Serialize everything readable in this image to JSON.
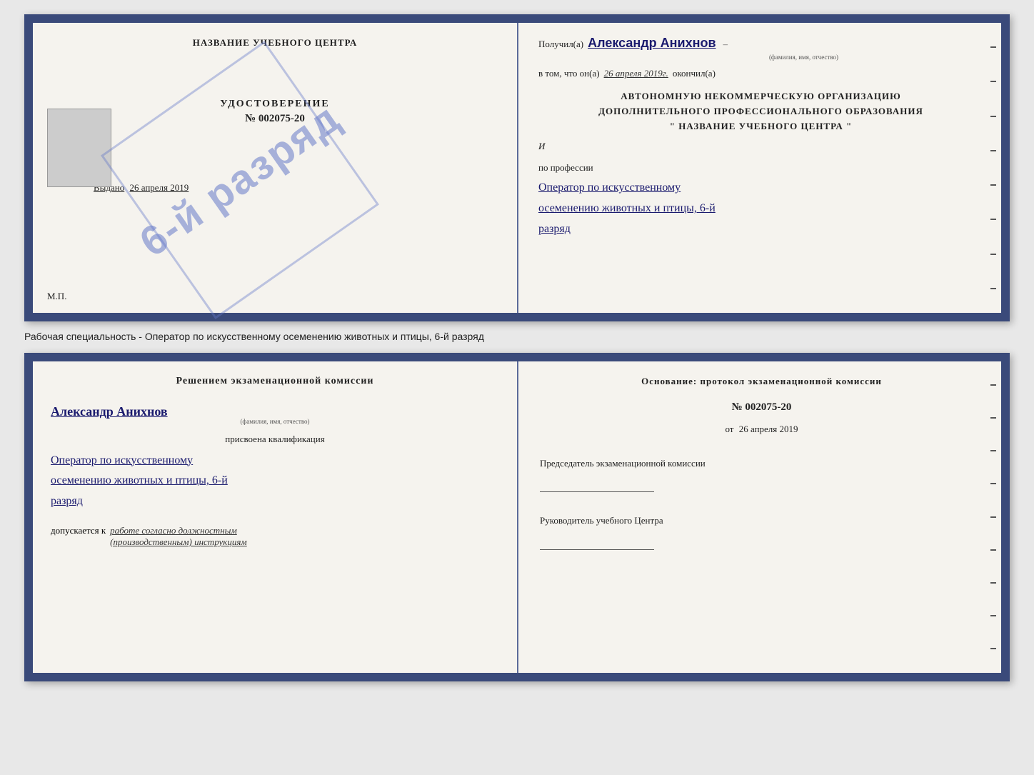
{
  "page": {
    "background": "#e8e8e8"
  },
  "top_cert": {
    "left": {
      "center_name": "НАЗВАНИЕ УЧЕБНОГО ЦЕНТРА",
      "photo_alt": "Фото",
      "cert_title": "УДОСТОВЕРЕНИЕ",
      "cert_number": "№ 002075-20",
      "issued_label": "Выдано",
      "issued_date": "26 апреля 2019",
      "mp_label": "М.П.",
      "stamp_text": "6-й разряд"
    },
    "right": {
      "received_label": "Получил(а)",
      "recipient_name": "Александр Анихнов",
      "name_subtitle": "(фамилия, имя, отчество)",
      "in_that_label": "в том, что он(а)",
      "date_value": "26 апреля 2019г.",
      "finished_label": "окончил(а)",
      "org_line1": "АВТОНОМНУЮ НЕКОММЕРЧЕСКУЮ ОРГАНИЗАЦИЮ",
      "org_line2": "ДОПОЛНИТЕЛЬНОГО ПРОФЕССИОНАЛЬНОГО ОБРАЗОВАНИЯ",
      "org_line3": "\"   НАЗВАНИЕ УЧЕБНОГО ЦЕНТРА   \"",
      "profession_label": "по профессии",
      "profession_value": "Оператор по искусственному осеменению животных и птицы, 6-й разряд"
    }
  },
  "middle_label": {
    "text": "Рабочая специальность - Оператор по искусственному осеменению животных и птицы, 6-й разряд"
  },
  "bottom_cert": {
    "left": {
      "decision_header": "Решением экзаменационной комиссии",
      "person_name": "Александр Анихнов",
      "name_subtitle": "(фамилия, имя, отчество)",
      "assigned_label": "присвоена квалификация",
      "qualification": "Оператор по искусственному осеменению животных и птицы, 6-й разряд",
      "allowed_label": "допускается к",
      "allowed_value": "работе согласно должностным (производственным) инструкциям"
    },
    "right": {
      "basis_label": "Основание: протокол экзаменационной комиссии",
      "protocol_number": "№ 002075-20",
      "protocol_date_prefix": "от",
      "protocol_date": "26 апреля 2019",
      "chairman_label": "Председатель экзаменационной комиссии",
      "director_label": "Руководитель учебного Центра"
    }
  }
}
